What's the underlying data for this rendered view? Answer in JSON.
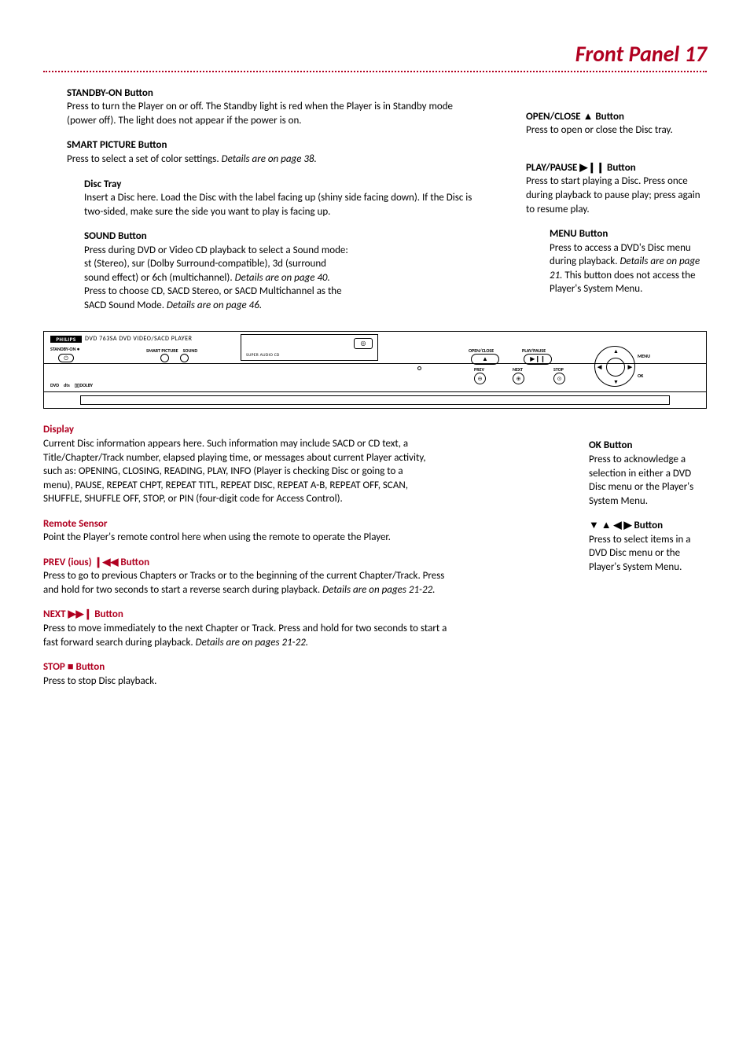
{
  "page": {
    "title_text": "Front Panel",
    "page_number": "17"
  },
  "left": {
    "standby": {
      "heading": "STANDBY-ON Button",
      "body": "Press to turn the Player on or off. The Standby light is red when the Player is in Standby mode (power off). The light does not appear if the power is on."
    },
    "smart_picture": {
      "heading": "SMART PICTURE Button",
      "body": "Press to select a set of color settings. ",
      "italic": "Details are on page 38."
    },
    "disc_tray": {
      "heading": "Disc Tray",
      "body": "Insert a Disc here. Load the Disc with the label facing up (shiny side facing down). If the Disc is two-sided, make sure the side you want to play is facing up."
    },
    "sound": {
      "heading": "SOUND Button",
      "body1": "Press during DVD or Video CD playback to select a Sound mode: st (Stereo), sur (Dolby Surround-compatible), 3d (surround sound effect) or 6ch (multichannel). ",
      "italic1": "Details are on page 40.",
      "body2": " Press to choose CD, SACD Stereo, or SACD Multichannel as the SACD Sound Mode. ",
      "italic2": "Details are on page 46."
    }
  },
  "right": {
    "open_close": {
      "heading": "OPEN/CLOSE ▲ Button",
      "body": "Press to open or close the Disc tray."
    },
    "play_pause": {
      "heading": "PLAY/PAUSE ▶❙❙ Button",
      "body": "Press to start playing a Disc. Press once during playback to pause play; press again to resume play."
    },
    "menu": {
      "heading": "MENU Button",
      "body1": "Press to access a DVD's Disc menu during playback. ",
      "italic": "Details are on page 21.",
      "body2": " This button does not access the Player's System Menu."
    }
  },
  "device": {
    "brand_model": "DVD 763SA DVD VIDEO/SACD PLAYER",
    "standby_on": "STANDBY-ON ●",
    "smart_picture": "SMART PICTURE",
    "sound": "SOUND",
    "sacd": "SUPER AUDIO CD",
    "open_close": "OPEN/CLOSE",
    "play_pause": "PLAY/PAUSE",
    "prev": "PREV",
    "next": "NEXT",
    "stop": "STOP",
    "menu": "MENU",
    "ok": "OK",
    "brand_logo": "PHILIPS"
  },
  "lower_left": {
    "display": {
      "heading": "Display",
      "body": "Current Disc information appears here. Such information may include SACD or CD text, a Title/Chapter/Track number, elapsed playing time, or messages about current Player activity, such as: OPENING, CLOSING, READING, PLAY, INFO (Player is checking Disc or going to a menu), PAUSE, REPEAT CHPT, REPEAT TITL, REPEAT DISC, REPEAT A-B, REPEAT OFF, SCAN, SHUFFLE, SHUFFLE OFF, STOP, or PIN (four-digit code for Access Control)."
    },
    "remote": {
      "heading": "Remote Sensor",
      "body": "Point the Player's remote control here when using the remote to operate the Player."
    },
    "prev": {
      "heading": "PREV (ious) ❙◀◀ Button",
      "body": "Press to go to previous Chapters or Tracks or to the beginning of the current Chapter/Track. Press and hold for two seconds to start a reverse search during playback. ",
      "italic": "Details are on pages 21-22."
    },
    "next": {
      "heading": "NEXT ▶▶❙ Button",
      "body": "Press to move immediately to the next Chapter or Track. Press and hold for two seconds to start a fast forward search during playback. ",
      "italic": "Details are on pages 21-22."
    },
    "stop": {
      "heading": "STOP ■ Button",
      "body": "Press to stop Disc playback."
    }
  },
  "lower_right": {
    "ok": {
      "heading": "OK Button",
      "body": "Press to acknowledge a selection in either a DVD Disc menu or the Player's System Menu."
    },
    "arrows": {
      "heading": "▼ ▲ ◀ ▶ Button",
      "body": "Press to select items in a DVD Disc menu or the Player's System Menu."
    }
  }
}
